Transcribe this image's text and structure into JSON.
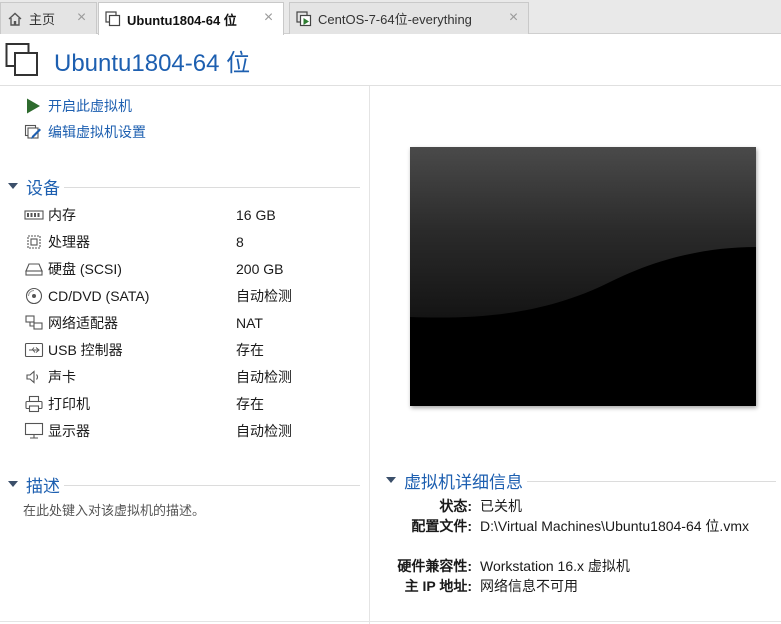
{
  "tabs": [
    {
      "label": "主页",
      "icon": "home-icon"
    },
    {
      "label": "Ubuntu1804-64 位",
      "icon": "vm-icon",
      "active": true
    },
    {
      "label": "CentOS-7-64位-everything",
      "icon": "vm-running-icon"
    }
  ],
  "header": {
    "title": "Ubuntu1804-64 位",
    "icon": "vm-icon"
  },
  "actions": [
    {
      "label": "开启此虚拟机",
      "icon": "play-icon"
    },
    {
      "label": "编辑虚拟机设置",
      "icon": "edit-settings-icon"
    }
  ],
  "devices": {
    "title": "设备",
    "items": [
      {
        "name": "内存",
        "value": "16 GB",
        "icon": "memory-icon"
      },
      {
        "name": "处理器",
        "value": "8",
        "icon": "cpu-icon"
      },
      {
        "name": "硬盘 (SCSI)",
        "value": "200 GB",
        "icon": "hard-disk-icon"
      },
      {
        "name": "CD/DVD (SATA)",
        "value": "自动检测",
        "icon": "cd-dvd-icon"
      },
      {
        "name": "网络适配器",
        "value": "NAT",
        "icon": "network-adapter-icon"
      },
      {
        "name": "USB 控制器",
        "value": "存在",
        "icon": "usb-icon"
      },
      {
        "name": "声卡",
        "value": "自动检测",
        "icon": "sound-icon"
      },
      {
        "name": "打印机",
        "value": "存在",
        "icon": "printer-icon"
      },
      {
        "name": "显示器",
        "value": "自动检测",
        "icon": "monitor-icon"
      }
    ]
  },
  "description": {
    "title": "描述",
    "placeholder": "在此处键入对该虚拟机的描述。"
  },
  "details": {
    "title": "虚拟机详细信息",
    "rows": [
      {
        "key": "状态:",
        "value": "已关机"
      },
      {
        "key": "配置文件:",
        "value": "D:\\Virtual Machines\\Ubuntu1804-64 位.vmx"
      },
      {
        "key": "硬件兼容性:",
        "value": "Workstation 16.x 虚拟机"
      },
      {
        "key": "主 IP 地址:",
        "value": "网络信息不可用"
      }
    ]
  },
  "colors": {
    "accent": "#1d5fb0",
    "play": "#2e7d32"
  }
}
